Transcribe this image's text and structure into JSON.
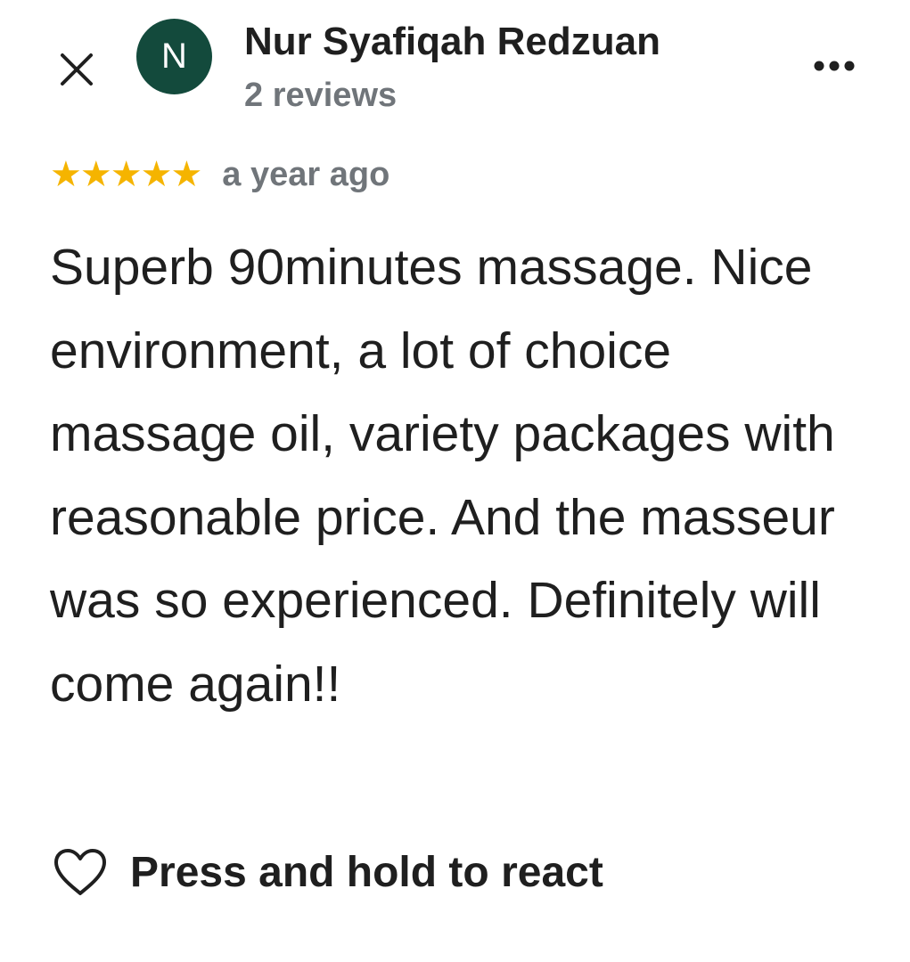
{
  "reviewer": {
    "avatar_initial": "N",
    "avatar_color": "#134a3c",
    "name": "Nur Syafiqah Redzuan",
    "review_count": "2 reviews"
  },
  "header": {
    "close_icon": "close-icon",
    "more_icon": "more-horizontal-icon"
  },
  "rating": {
    "stars": 5,
    "max_stars": 5,
    "star_color": "#f5b400",
    "time_ago": "a year ago"
  },
  "review": {
    "text": "Superb 90minutes massage. Nice environment, a lot of choice massage oil, variety packages with reasonable price. And the masseur was so experienced. Definitely will come again!!"
  },
  "actions": {
    "react_icon": "heart-outline-icon",
    "react_label": "Press and hold to react"
  }
}
